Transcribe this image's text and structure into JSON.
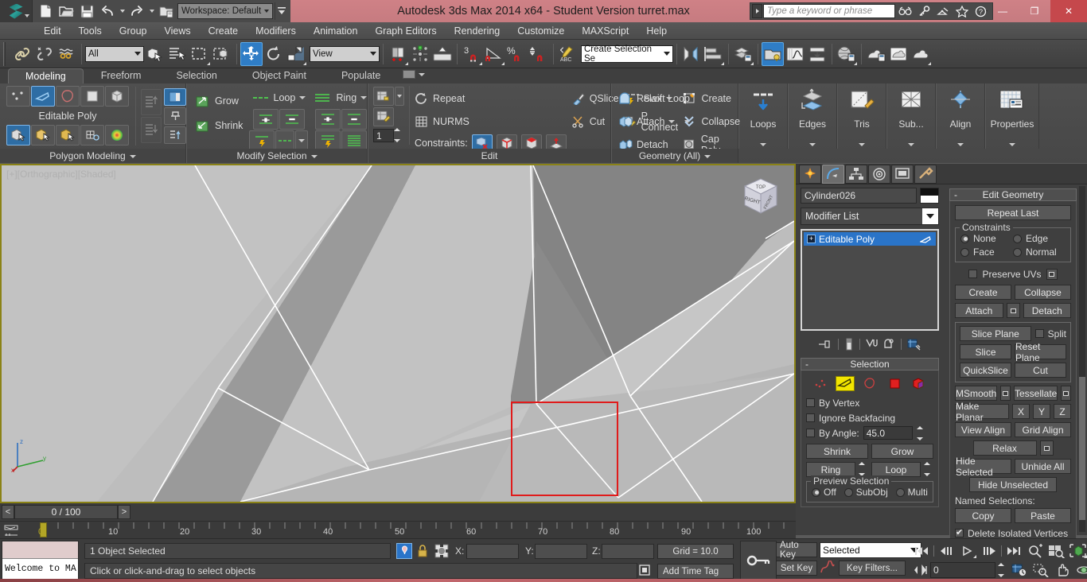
{
  "titlebar": {
    "app_title": "Autodesk 3ds Max  2014 x64  - Student Version    turret.max",
    "workspace_label": "Workspace: Default",
    "quick_access": [
      {
        "name": "new-file-icon",
        "label": "New"
      },
      {
        "name": "open-file-icon",
        "label": "Open"
      },
      {
        "name": "save-file-icon",
        "label": "Save"
      },
      {
        "name": "undo-icon",
        "label": "Undo"
      },
      {
        "name": "redo-icon",
        "label": "Redo"
      },
      {
        "name": "project-folder-icon",
        "label": "Set Project Folder"
      }
    ],
    "infocenter": {
      "placeholder": "Type a keyword or phrase",
      "buttons": [
        "search-icon",
        "subscription-key-icon",
        "comm-center-icon",
        "favorites-star-icon",
        "help-icon"
      ]
    },
    "window_buttons": {
      "minimize": "—",
      "restore": "❐",
      "close": "✕"
    }
  },
  "menubar": {
    "items": [
      "Edit",
      "Tools",
      "Group",
      "Views",
      "Create",
      "Modifiers",
      "Animation",
      "Graph Editors",
      "Rendering",
      "Customize",
      "MAXScript",
      "Help"
    ]
  },
  "main_toolbar": {
    "selection_filter": "All",
    "reference_coord": "View",
    "named_selection_set": "Create Selection Se",
    "buttons": [
      "select-link-icon",
      "unlink-icon",
      "bind-space-warp-icon",
      "select-object-icon",
      "select-by-name-icon",
      "rectangular-select-region-icon",
      "window-crossing-icon",
      "select-and-move-icon",
      "select-and-rotate-icon",
      "select-and-scale-icon",
      "use-pivot-center-icon",
      "use-selection-center-icon",
      "mirror-icon",
      "snap-toggle-3d-icon",
      "angle-snap-icon",
      "percent-snap-icon",
      "spinner-snap-icon",
      "edit-named-selection-sets-icon",
      "mirror-geometry-icon",
      "align-icon",
      "layer-manager-icon",
      "scene-explorer-icon",
      "curve-editor-icon",
      "schematic-view-icon",
      "material-editor-icon",
      "render-setup-icon",
      "rendered-frame-window-icon",
      "render-production-icon"
    ]
  },
  "ribbon": {
    "tabs": [
      {
        "label": "Modeling",
        "active": true
      },
      {
        "label": "Freeform",
        "active": false
      },
      {
        "label": "Selection",
        "active": false
      },
      {
        "label": "Object Paint",
        "active": false
      },
      {
        "label": "Populate",
        "active": false
      }
    ],
    "panels": [
      {
        "title": "Polygon Modeling",
        "subobject_row": [
          "vertex-icon",
          "edge-icon",
          "border-icon",
          "polygon-icon",
          "element-icon"
        ],
        "stack_label": "Editable Poly",
        "tool_row": [
          "generate-topology-icon",
          "repeat-last-icon",
          "paint-deform-icon",
          "preserve-uvs-icon"
        ],
        "bottom_row": [
          "convert-to-poly-icon",
          "convert-to-mesh-icon",
          "convert-to-patch-icon",
          "apply-turbosmooth-icon",
          "use-soft-selection-icon"
        ]
      },
      {
        "title": "Modify Selection",
        "grow_label": "Grow",
        "shrink_label": "Shrink",
        "loop_label": "Loop",
        "ring_label": "Ring"
      },
      {
        "title": "Edit",
        "repeat_label": "Repeat",
        "nurms_label": "NURMS",
        "qslice_label": "QSlice",
        "cut_label": "Cut",
        "swift_loop_label": "Swift Loop",
        "p_connect_label": "P Connect",
        "constraints_label": "Constraints:",
        "constraint_buttons": [
          "constraint-none-icon",
          "constraint-edge-icon",
          "constraint-face-icon",
          "constraint-normal-icon"
        ],
        "iteration_value": "1"
      },
      {
        "title": "Geometry (All)",
        "relax_label": "Relax",
        "attach_label": "Attach",
        "detach_label": "Detach",
        "create_label": "Create",
        "collapse_label": "Collapse",
        "cap_poly_label": "Cap Poly"
      }
    ],
    "big_buttons": [
      {
        "label": "Loops",
        "icon": "loops-icon"
      },
      {
        "label": "Edges",
        "icon": "edges-icon"
      },
      {
        "label": "Tris",
        "icon": "tris-icon"
      },
      {
        "label": "Sub...",
        "icon": "subdivision-icon"
      },
      {
        "label": "Align",
        "icon": "align-icon"
      },
      {
        "label": "Properties",
        "icon": "properties-icon"
      }
    ]
  },
  "viewport": {
    "label": "[+][Orthographic][Shaded]",
    "viewcube_faces": {
      "front": "RIGHT",
      "side": "FRONT",
      "top": "TOP"
    },
    "axis_labels": {
      "z": "z",
      "y": "y",
      "x": "x"
    },
    "selection_rect_color": "#e01b1b"
  },
  "command_panel": {
    "tabs": [
      "create-tab-icon",
      "modify-tab-icon",
      "hierarchy-tab-icon",
      "motion-tab-icon",
      "display-tab-icon",
      "utilities-tab-icon"
    ],
    "active_tab_index": 1,
    "object_name": "Cylinder026",
    "modifier_list_label": "Modifier List",
    "stack_items": [
      {
        "label": "Editable Poly",
        "selected": true
      }
    ],
    "stack_tool_icons": [
      "pin-stack-icon",
      "show-end-result-icon",
      "make-unique-icon",
      "remove-modifier-icon",
      "configure-modifier-sets-icon"
    ],
    "selection_rollout": {
      "title": "Selection",
      "subobject_icons": [
        "vertex-icon",
        "edge-icon",
        "border-icon",
        "polygon-icon",
        "element-icon"
      ],
      "active_subobject_index": 1,
      "by_vertex_label": "By Vertex",
      "by_vertex_checked": false,
      "ignore_backfacing_label": "Ignore Backfacing",
      "ignore_backfacing_checked": false,
      "by_angle_label": "By Angle:",
      "by_angle_checked": false,
      "by_angle_value": "45.0",
      "shrink_label": "Shrink",
      "grow_label": "Grow",
      "ring_label": "Ring",
      "loop_label": "Loop",
      "preview_selection_label": "Preview Selection",
      "preview_options": [
        {
          "label": "Off",
          "selected": true
        },
        {
          "label": "SubObj",
          "selected": false
        },
        {
          "label": "Multi",
          "selected": false
        }
      ]
    },
    "edit_geometry_rollout": {
      "title": "Edit Geometry",
      "repeat_last_label": "Repeat Last",
      "constraints_label": "Constraints",
      "constraints_options": [
        {
          "label": "None",
          "selected": true
        },
        {
          "label": "Edge",
          "selected": false
        },
        {
          "label": "Face",
          "selected": false
        },
        {
          "label": "Normal",
          "selected": false
        }
      ],
      "preserve_uvs_label": "Preserve UVs",
      "preserve_uvs_checked": false,
      "create_label": "Create",
      "collapse_label": "Collapse",
      "attach_label": "Attach",
      "detach_label": "Detach",
      "slice_plane_label": "Slice Plane",
      "split_label": "Split",
      "split_checked": false,
      "slice_label": "Slice",
      "reset_plane_label": "Reset Plane",
      "quickslice_label": "QuickSlice",
      "cut_label": "Cut",
      "msmooth_label": "MSmooth",
      "tessellate_label": "Tessellate",
      "make_planar_label": "Make Planar",
      "axis_x_label": "X",
      "axis_y_label": "Y",
      "axis_z_label": "Z",
      "view_align_label": "View Align",
      "grid_align_label": "Grid Align",
      "relax_label": "Relax",
      "hide_selected_label": "Hide Selected",
      "unhide_all_label": "Unhide All",
      "hide_unselected_label": "Hide Unselected",
      "named_selections_label": "Named Selections:",
      "copy_label": "Copy",
      "paste_label": "Paste",
      "delete_isolated_vertices_label": "Delete Isolated Vertices",
      "delete_isolated_vertices_checked": true
    }
  },
  "timeslider": {
    "prev_label": "<",
    "next_label": ">",
    "frame_label": "0 / 100",
    "track_ticks": [
      "10",
      "20",
      "30",
      "40",
      "50",
      "60",
      "70",
      "80",
      "90",
      "100"
    ]
  },
  "statusbar": {
    "maxscript_listener_text": "Welcome to MA",
    "selection_status": "1 Object Selected",
    "prompt_text": "Click or click-and-drag to select objects",
    "coord_labels": {
      "x": "X:",
      "y": "Y:",
      "z": "Z:"
    },
    "coord_values": {
      "x": "",
      "y": "",
      "z": ""
    },
    "grid_label": "Grid = 10.0",
    "add_time_tag_label": "Add Time Tag",
    "auto_key_label": "Auto Key",
    "set_key_label": "Set Key",
    "key_mode_value": "Selected",
    "key_filters_label": "Key Filters...",
    "current_frame_value": "0",
    "nav_icons": [
      "zoom-icon",
      "zoom-all-icon",
      "zoom-extents-icon",
      "zoom-extents-all-icon",
      "zoom-region-icon",
      "field-of-view-icon",
      "pan-icon",
      "orbit-icon",
      "maximize-viewport-icon"
    ],
    "playback_icons": [
      "go-to-start-icon",
      "previous-frame-icon",
      "play-animation-icon",
      "next-frame-icon",
      "go-to-end-icon"
    ]
  }
}
